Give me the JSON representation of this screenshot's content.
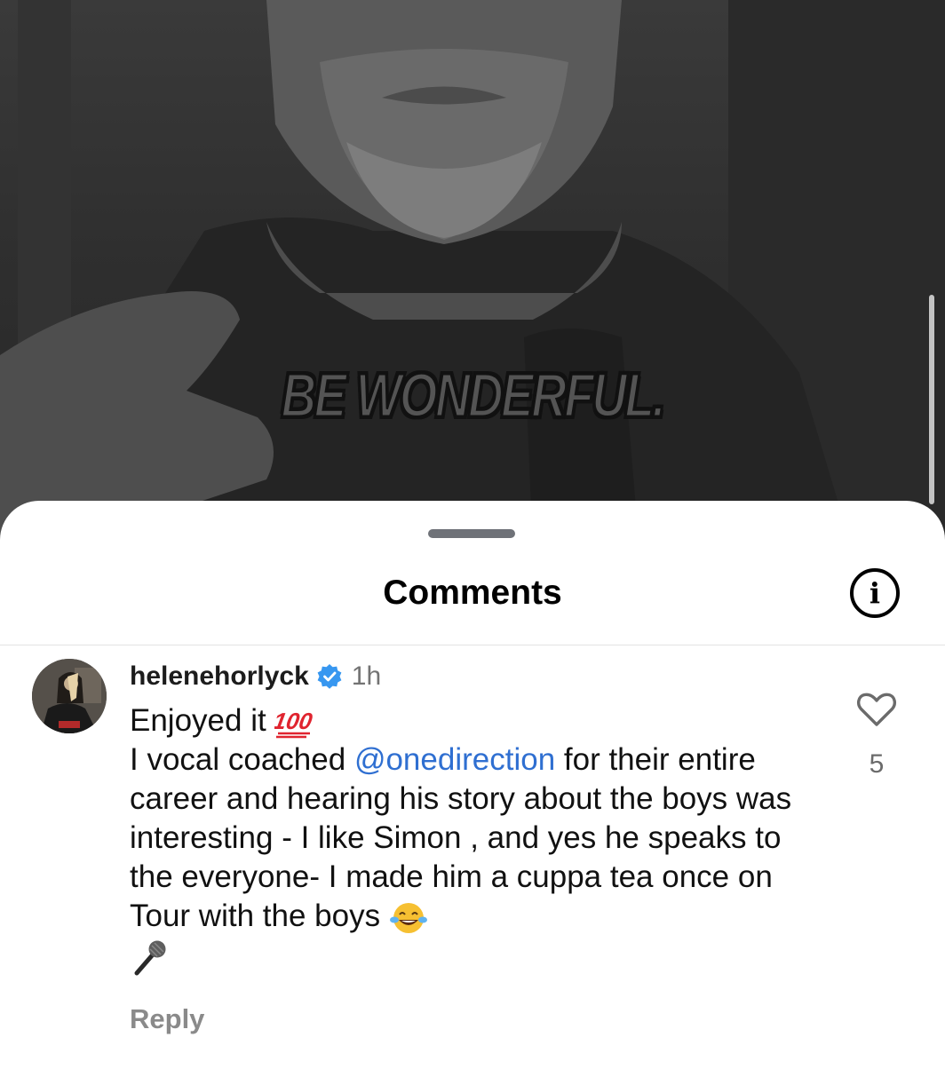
{
  "video": {
    "overlay_text": "BE WONDERFUL."
  },
  "sheet": {
    "title": "Comments",
    "info_icon": "info-icon",
    "info_glyph": "i"
  },
  "comment": {
    "username": "helenehorlyck",
    "verified": true,
    "time": "1h",
    "line1": "Enjoyed it",
    "text_before_mention": "I vocal coached ",
    "mention": "@onedirection",
    "text_after_mention": " for their entire career and hearing his story about the boys was interesting - I like Simon , and yes he speaks to the everyone- I made him a cuppa tea once on Tour with the boys ",
    "emojis": [
      "hundred-points-icon",
      "tears-of-joy-icon",
      "microphone-icon"
    ],
    "reply_label": "Reply",
    "like_count": "5"
  },
  "colors": {
    "mention": "#2f6fd1",
    "verified_badge": "#3797f0",
    "reply": "#8a8a8a"
  }
}
